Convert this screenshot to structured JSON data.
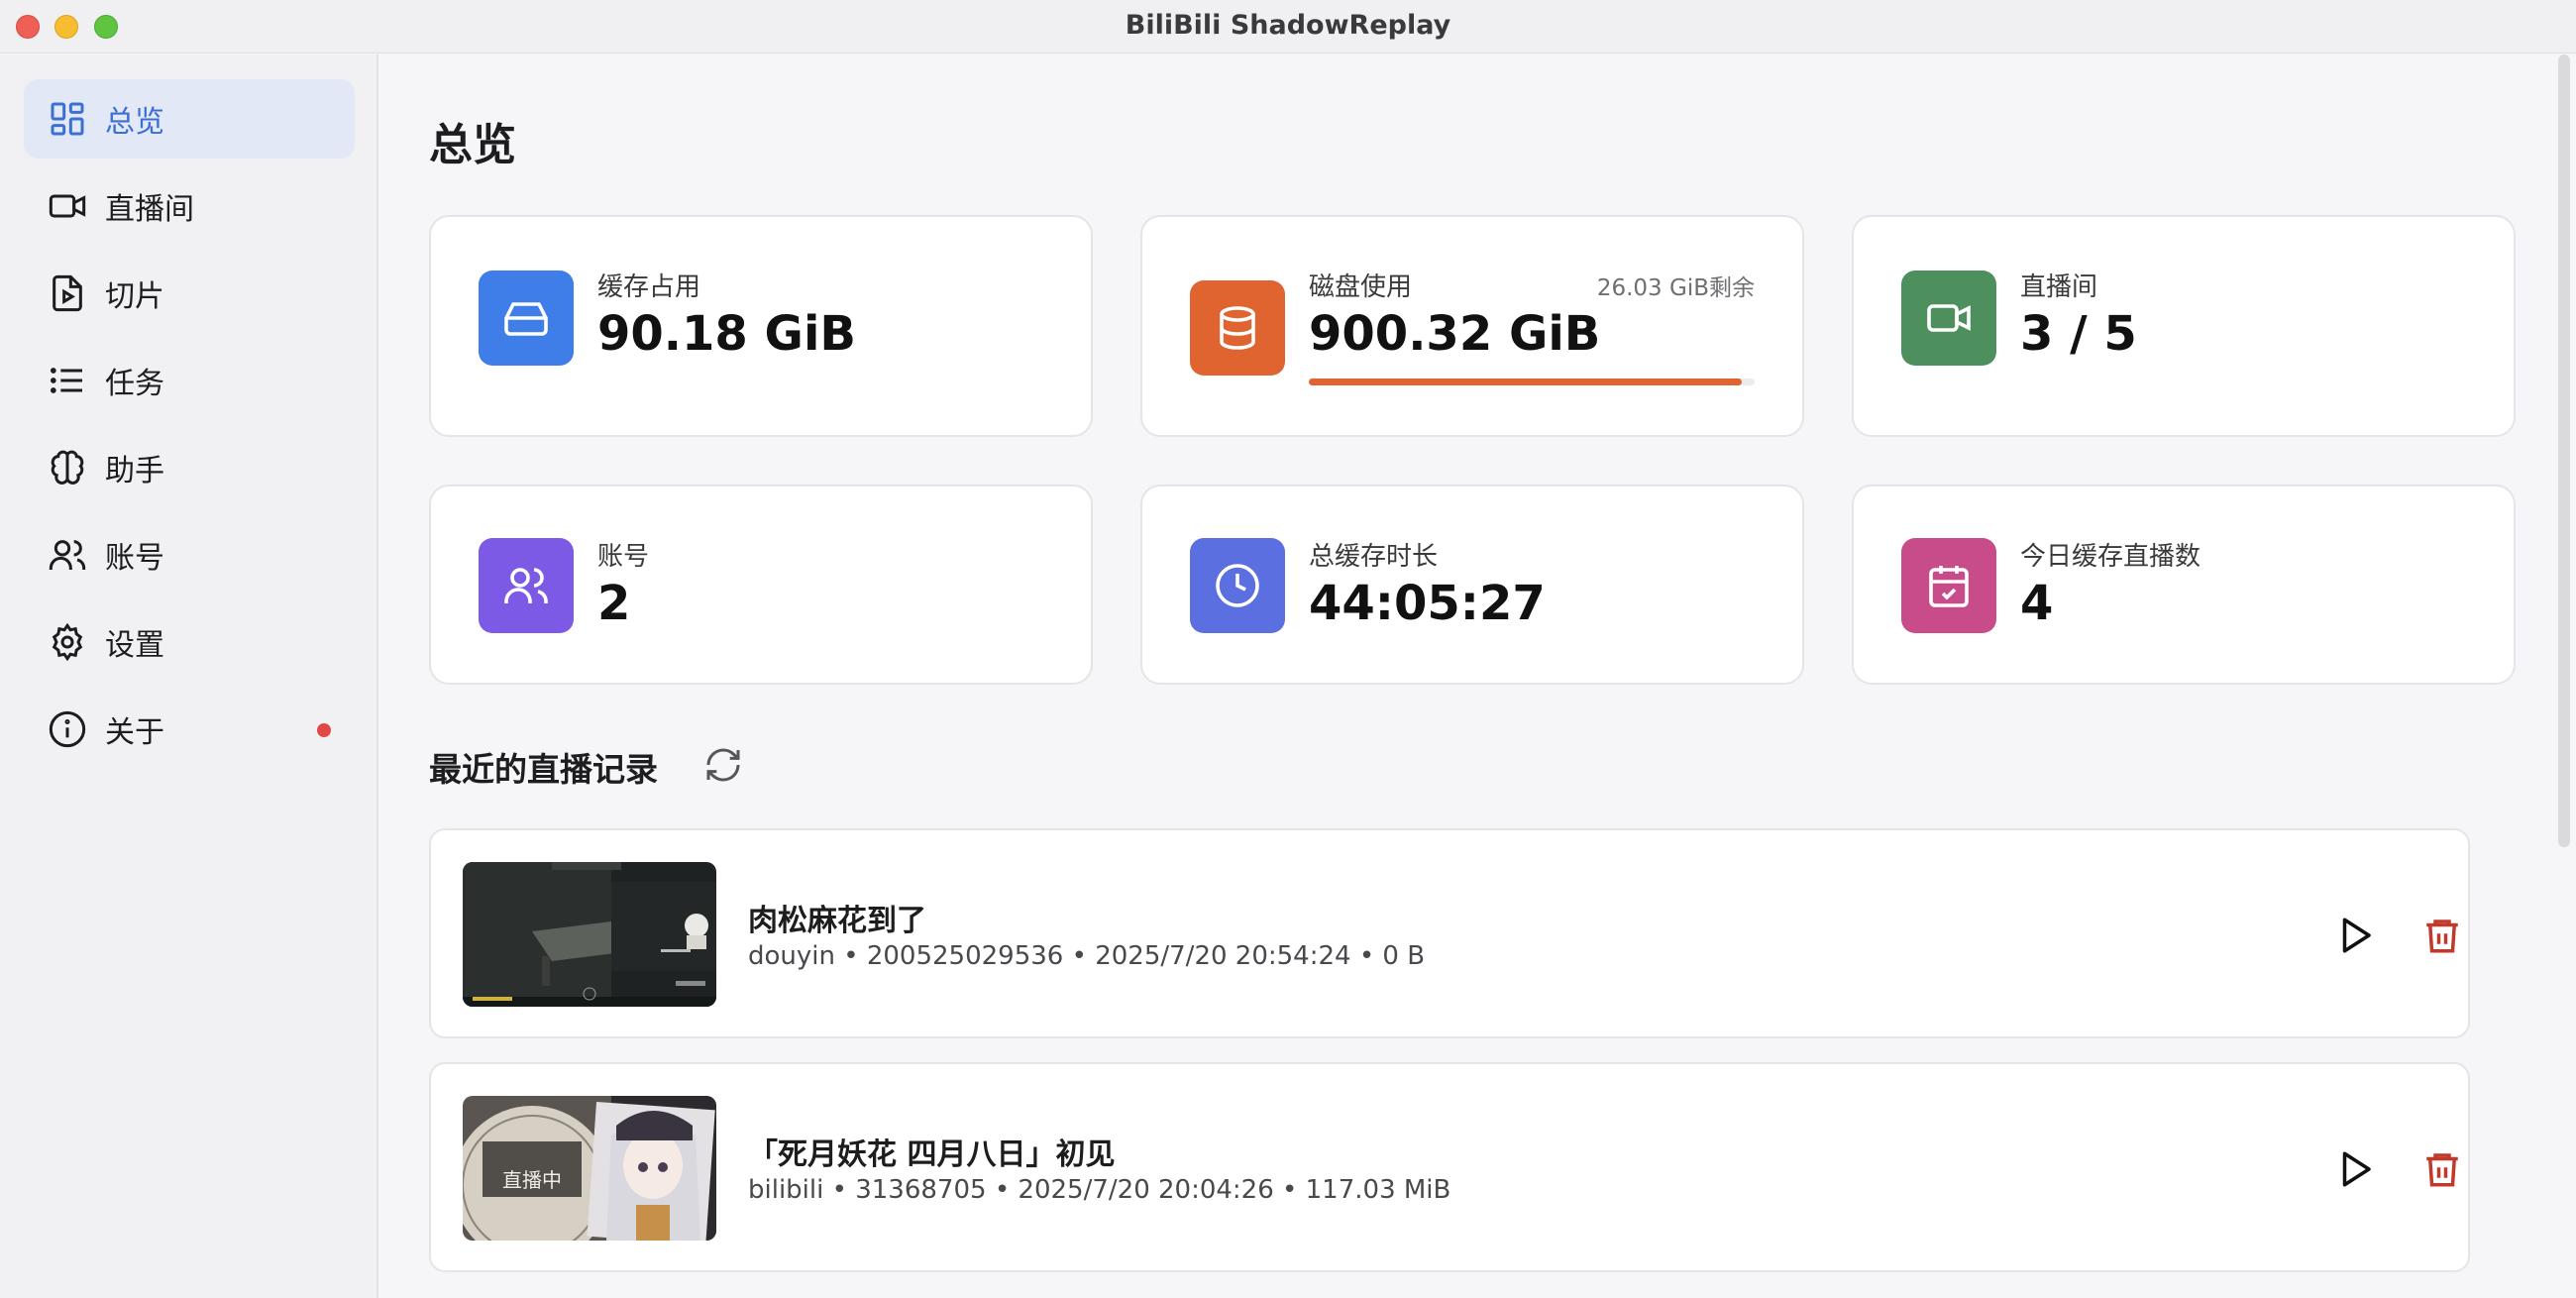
{
  "window": {
    "title": "BiliBili ShadowReplay"
  },
  "sidebar": {
    "items": [
      {
        "label": "总览",
        "icon": "dashboard-icon",
        "active": true
      },
      {
        "label": "直播间",
        "icon": "video-camera-icon"
      },
      {
        "label": "切片",
        "icon": "file-video-icon"
      },
      {
        "label": "任务",
        "icon": "list-icon"
      },
      {
        "label": "助手",
        "icon": "brain-icon"
      },
      {
        "label": "账号",
        "icon": "users-icon"
      },
      {
        "label": "设置",
        "icon": "gear-icon"
      },
      {
        "label": "关于",
        "icon": "info-icon",
        "badge": "notification-dot"
      }
    ]
  },
  "main": {
    "title": "总览",
    "stats": [
      {
        "label": "缓存占用",
        "value": "90.18 GiB",
        "icon": "drive-icon",
        "color": "#3f7ee8"
      },
      {
        "label": "磁盘使用",
        "value": "900.32 GiB",
        "extra": "26.03 GiB剩余",
        "progress": 0.972,
        "icon": "database-icon",
        "color": "#e0642f"
      },
      {
        "label": "直播间",
        "value": "3 / 5",
        "icon": "video-camera-icon",
        "color": "#4e8f5e"
      },
      {
        "label": "账号",
        "value": "2",
        "icon": "users-icon",
        "color": "#7c5ae6"
      },
      {
        "label": "总缓存时长",
        "value": "44:05:27",
        "icon": "clock-icon",
        "color": "#5b6fe0"
      },
      {
        "label": "今日缓存直播数",
        "value": "4",
        "icon": "calendar-check-icon",
        "color": "#c94c8a"
      }
    ],
    "recent": {
      "title": "最近的直播记录",
      "items": [
        {
          "title": "肉松麻花到了",
          "meta": "douyin • 200525029536 • 2025/7/20 20:54:24 • 0 B"
        },
        {
          "title": "「死月妖花 四月八日」初见",
          "meta": "bilibili • 31368705 • 2025/7/20 20:04:26 • 117.03 MiB",
          "thumb_text": "直播中"
        }
      ]
    }
  }
}
